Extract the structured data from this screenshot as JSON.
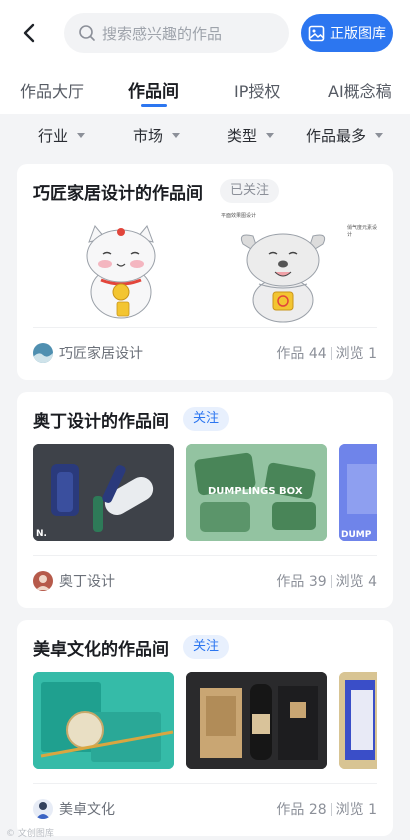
{
  "header": {
    "search_placeholder": "搜索感兴趣的作品",
    "gallery_button": "正版图库"
  },
  "tabs": [
    {
      "label": "作品大厅",
      "active": false
    },
    {
      "label": "作品间",
      "active": true
    },
    {
      "label": "IP授权",
      "active": false
    },
    {
      "label": "AI概念稿",
      "active": false
    }
  ],
  "filters": [
    {
      "label": "行业"
    },
    {
      "label": "市场"
    },
    {
      "label": "类型"
    },
    {
      "label": "作品最多"
    }
  ],
  "studios": [
    {
      "title": "巧匠家居设计的作品间",
      "follow_label": "已关注",
      "followed": true,
      "preview_captions": [
        "平面效果图设计",
        "俏气度元素设计"
      ],
      "name": "巧匠家居设计",
      "works": "作品 44",
      "views": "浏览 1"
    },
    {
      "title": "奥丁设计的作品间",
      "follow_label": "关注",
      "followed": false,
      "thumb_captions": [
        "N.",
        "DUMPLINGS BOX",
        "DUMP"
      ],
      "name": "奥丁设计",
      "works": "作品 39",
      "views": "浏览 4"
    },
    {
      "title": "美卓文化的作品间",
      "follow_label": "关注",
      "followed": false,
      "name": "美卓文化",
      "works": "作品 28",
      "views": "浏览 1"
    }
  ],
  "watermark": "© 文创图库",
  "colors": {
    "accent": "#2c76f0",
    "background": "#f3f4f6"
  }
}
